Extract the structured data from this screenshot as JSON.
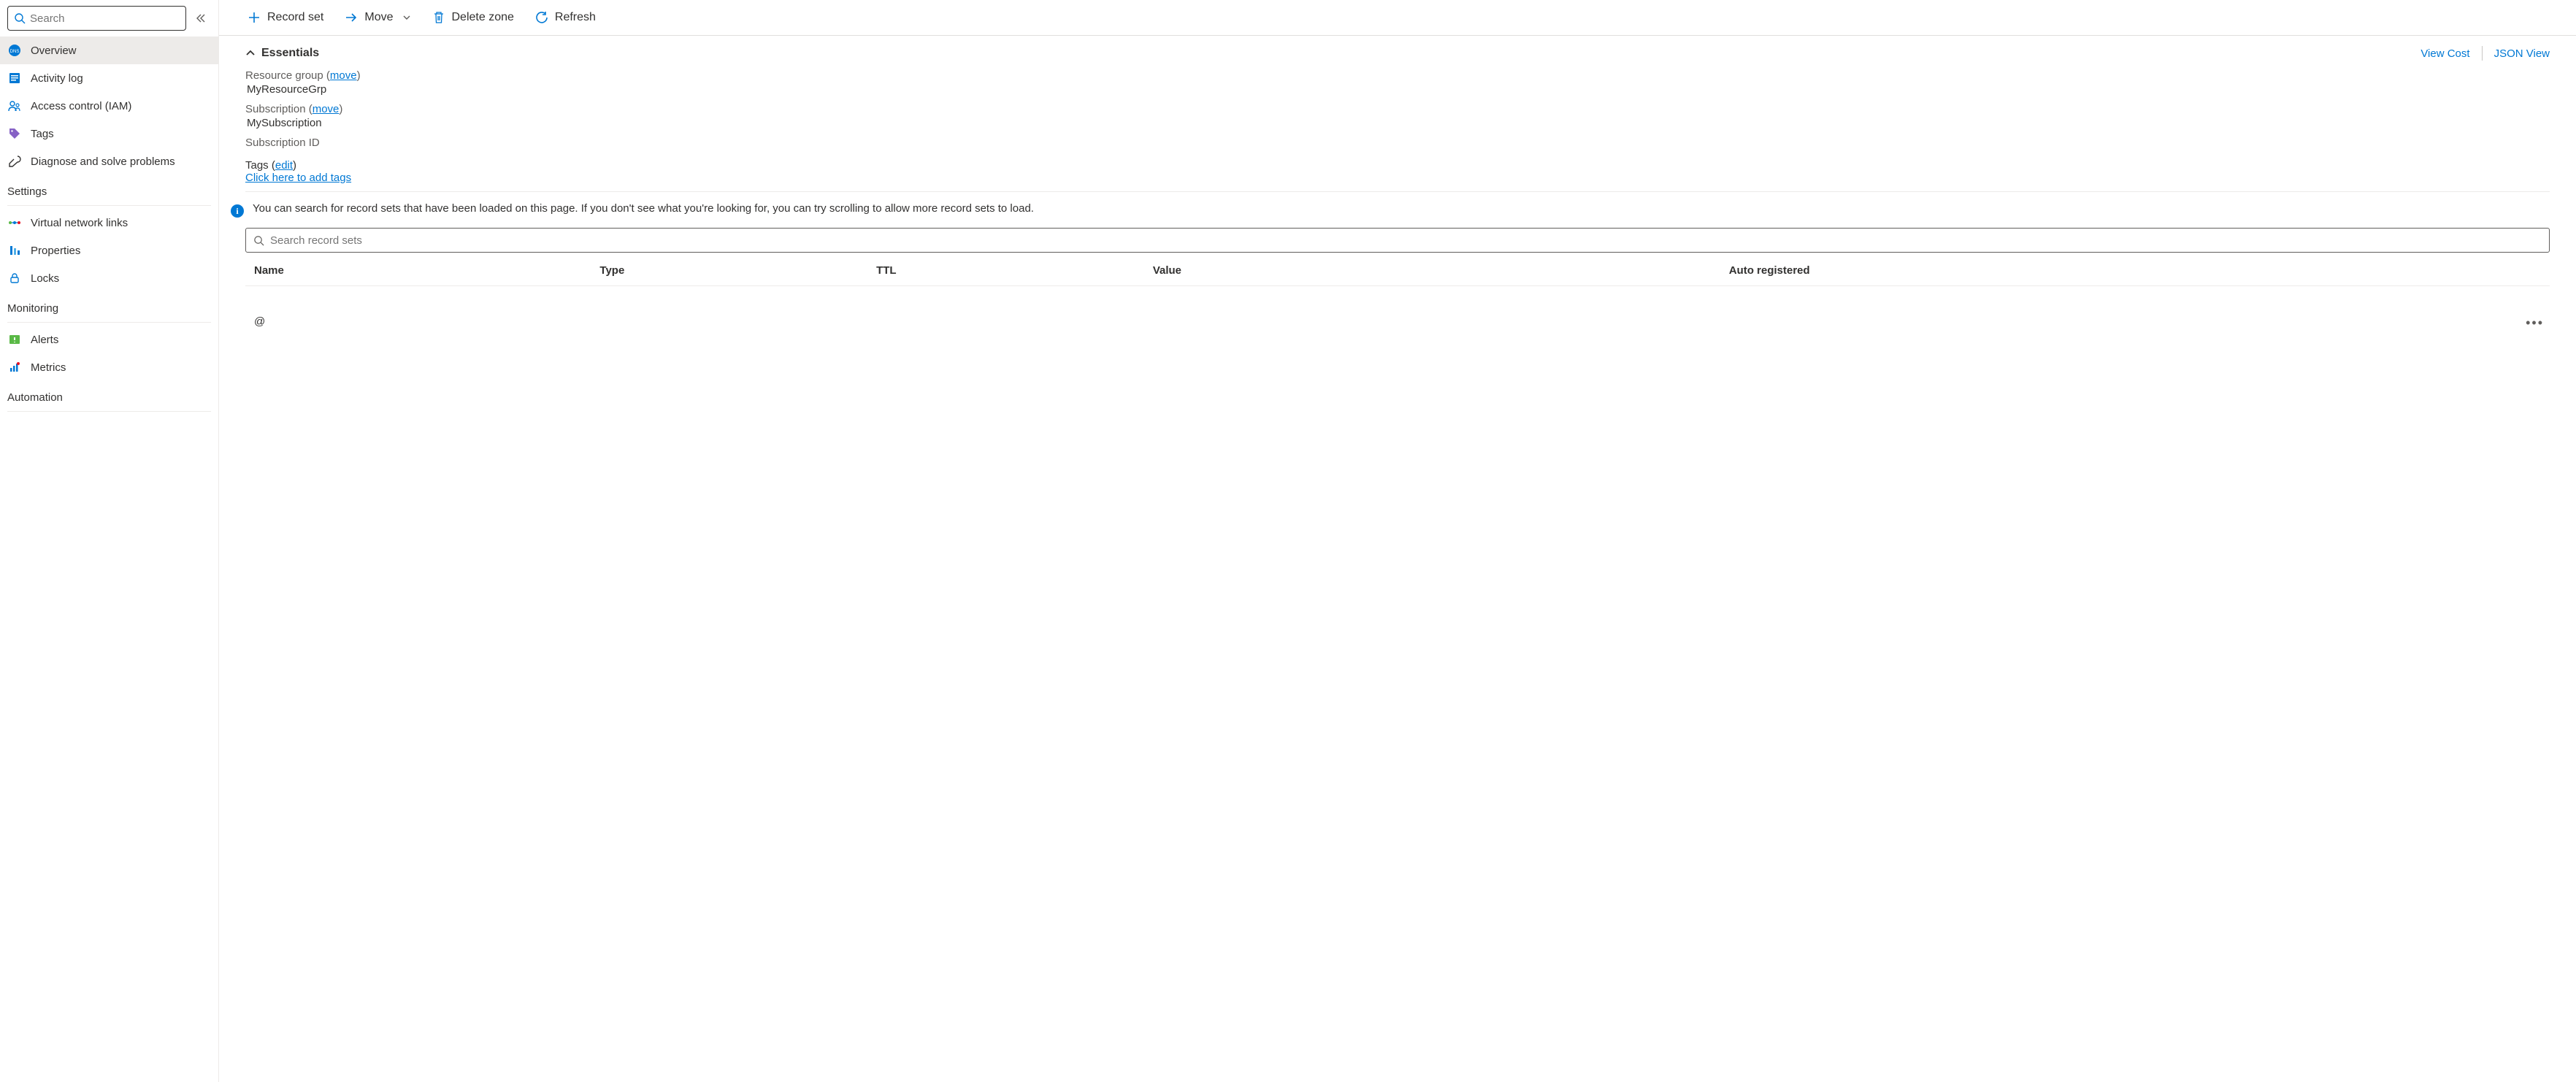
{
  "sidebar": {
    "search_placeholder": "Search",
    "items_top": [
      {
        "label": "Overview",
        "icon": "dns-icon",
        "active": true
      },
      {
        "label": "Activity log",
        "icon": "activity-log-icon",
        "active": false
      },
      {
        "label": "Access control (IAM)",
        "icon": "iam-icon",
        "active": false
      },
      {
        "label": "Tags",
        "icon": "tags-icon",
        "active": false
      },
      {
        "label": "Diagnose and solve problems",
        "icon": "diagnose-icon",
        "active": false
      }
    ],
    "section_settings": "Settings",
    "items_settings": [
      {
        "label": "Virtual network links",
        "icon": "vnet-links-icon"
      },
      {
        "label": "Properties",
        "icon": "properties-icon"
      },
      {
        "label": "Locks",
        "icon": "locks-icon"
      }
    ],
    "section_monitoring": "Monitoring",
    "items_monitoring": [
      {
        "label": "Alerts",
        "icon": "alerts-icon"
      },
      {
        "label": "Metrics",
        "icon": "metrics-icon"
      }
    ],
    "section_automation": "Automation"
  },
  "cmdbar": {
    "record_set": "Record set",
    "move": "Move",
    "delete_zone": "Delete zone",
    "refresh": "Refresh"
  },
  "essentials": {
    "title": "Essentials",
    "view_cost": "View Cost",
    "json_view": "JSON View",
    "resource_group_label": "Resource group",
    "resource_group_move": "move",
    "resource_group_value": "MyResourceGrp",
    "subscription_label": "Subscription",
    "subscription_move": "move",
    "subscription_value": "MySubscription",
    "subscription_id_label": "Subscription ID",
    "tags_label": "Tags",
    "tags_edit": "edit",
    "tags_add": "Click here to add tags"
  },
  "info_text": "You can search for record sets that have been loaded on this page. If you don't see what you're looking for, you can try scrolling to allow more record sets to load.",
  "records": {
    "search_placeholder": "Search record sets",
    "columns": {
      "name": "Name",
      "type": "Type",
      "ttl": "TTL",
      "value": "Value",
      "auto": "Auto registered"
    },
    "rows": [
      {
        "name": "@",
        "type": "",
        "ttl": "",
        "value": "",
        "auto": ""
      }
    ]
  }
}
